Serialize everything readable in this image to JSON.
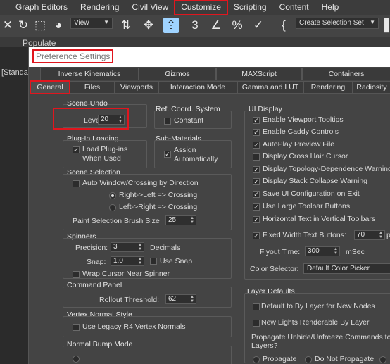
{
  "menubar": {
    "items": [
      "Graph Editors",
      "Rendering",
      "Civil View",
      "Customize",
      "Scripting",
      "Content",
      "Help"
    ]
  },
  "toolbar": {
    "view_dropdown": "View",
    "selection_set_placeholder": "Create Selection Set"
  },
  "ribbon": {
    "populate_label": "Populate"
  },
  "viewport": {
    "label": "[Standa"
  },
  "dialog": {
    "title": "Preference Settings",
    "tabs_row1": [
      "Inverse Kinematics",
      "Gizmos",
      "MAXScript",
      "Containers"
    ],
    "tabs_row2": [
      "General",
      "Files",
      "Viewports",
      "Interaction Mode",
      "Gamma and LUT",
      "Rendering",
      "Radiosity"
    ]
  },
  "general": {
    "scene_undo": {
      "header": "Scene Undo",
      "levels_label": "Levels:",
      "levels_value": "20"
    },
    "ref_coord": {
      "header": "Ref. Coord. System",
      "constant_label": "Constant"
    },
    "plugin_loading": {
      "header": "Plug-In Loading",
      "load_label": "Load Plug-ins",
      "load_label2": "When Used"
    },
    "sub_materials": {
      "header": "Sub-Materials",
      "assign_label": "Assign",
      "assign_label2": "Automatically"
    },
    "scene_selection": {
      "header": "Scene Selection",
      "auto_window": "Auto Window/Crossing by Direction",
      "right_left": "Right->Left => Crossing",
      "left_right": "Left->Right => Crossing",
      "brush_label": "Paint Selection Brush Size",
      "brush_value": "25"
    },
    "spinners": {
      "header": "Spinners",
      "precision_label": "Precision:",
      "precision_value": "3",
      "decimals_label": "Decimals",
      "snap_label": "Snap:",
      "snap_value": "1.0",
      "use_snap_label": "Use Snap",
      "wrap_label": "Wrap Cursor Near Spinner"
    },
    "command_panel": {
      "header": "Command Panel",
      "rollout_label": "Rollout Threshold:",
      "rollout_value": "62"
    },
    "vertex_normal": {
      "header": "Vertex Normal Style",
      "legacy_label": "Use Legacy R4 Vertex Normals"
    },
    "normal_bump": {
      "header": "Normal Bump Mode"
    },
    "ui_display": {
      "header": "UI Display",
      "items": [
        {
          "label": "Enable Viewport Tooltips",
          "checked": true
        },
        {
          "label": "Enable Caddy Controls",
          "checked": true
        },
        {
          "label": "AutoPlay Preview File",
          "checked": true
        },
        {
          "label": "Display Cross Hair Cursor",
          "checked": false
        },
        {
          "label": "Display Topology-Dependence Warning",
          "checked": true
        },
        {
          "label": "Display Stack Collapse Warning",
          "checked": true
        },
        {
          "label": "Save UI Configuration on Exit",
          "checked": true
        },
        {
          "label": "Use Large Toolbar Buttons",
          "checked": true
        },
        {
          "label": "Horizontal Text in Vertical Toolbars",
          "checked": true
        }
      ],
      "fixed_width_label": "Fixed Width Text Buttons:",
      "fixed_width_value": "70",
      "fixed_width_suffix": "p",
      "flyout_label": "Flyout Time:",
      "flyout_value": "300",
      "flyout_unit": "mSec",
      "color_selector_label": "Color Selector:",
      "color_selector_value": "Default Color Picker"
    },
    "layer_defaults": {
      "header": "Layer Defaults",
      "default_bylayer": "Default to By Layer for New Nodes",
      "new_lights": "New Lights Renderable By Layer",
      "propagate_question": "Propagate Unhide/Unfreeze Commands to",
      "propagate_question2": "Layers?",
      "propagate": "Propagate",
      "do_not_propagate": "Do Not Propagate"
    }
  }
}
